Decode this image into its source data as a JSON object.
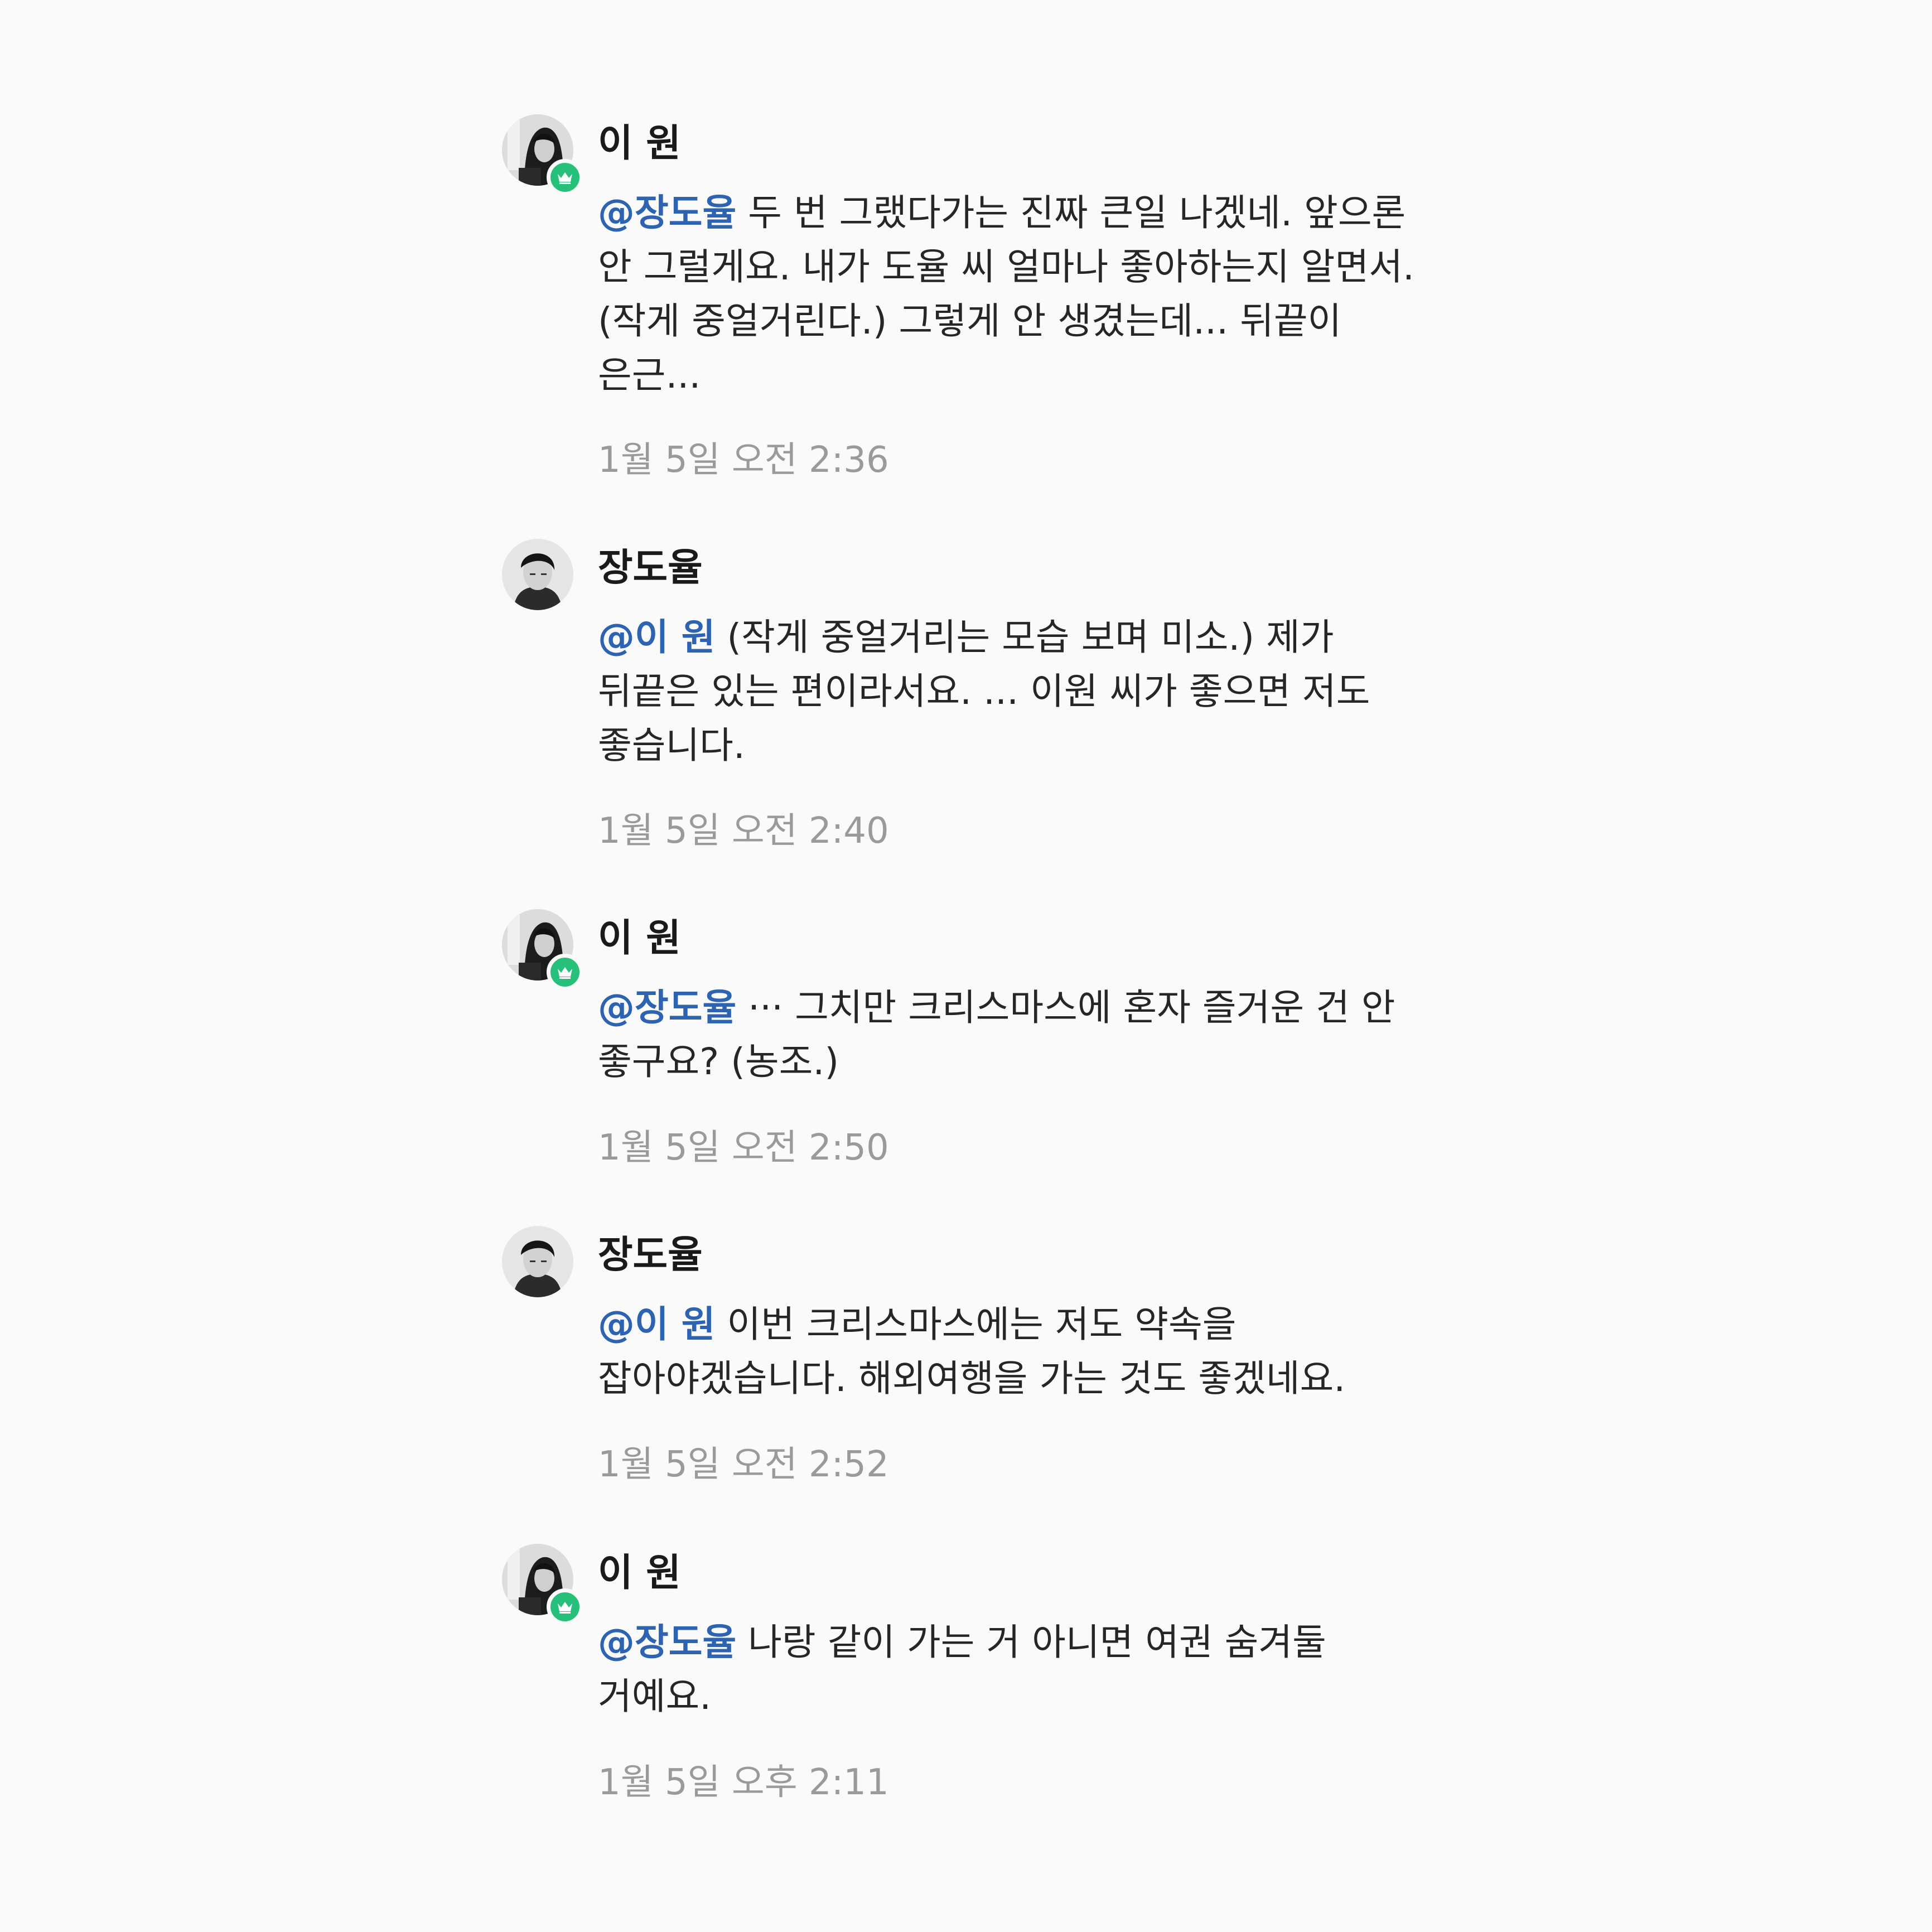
{
  "comments": [
    {
      "author": "이 원",
      "avatar_icon": "profile-photo-woman-dark-hair",
      "badge_icon": "crown-icon",
      "mention": "@장도율",
      "text": "두 번 그랬다가는 진짜 큰일 나겠네. 앞으론 안 그럴게요. 내가 도율 씨 얼마나 좋아하는지 알면서. (작게 중얼거린다.) 그렇게 안 생겼는데... 뒤끝이 은근...",
      "timestamp": "1월 5일 오전 2:36"
    },
    {
      "author": "장도율",
      "avatar_icon": "profile-photo-man-dark-hair",
      "badge_icon": "",
      "mention": "@이 원",
      "text": "(작게 중얼거리는 모습 보며 미소.) 제가 뒤끝은 있는 편이라서요. ... 이원 씨가 좋으면 저도 좋습니다.",
      "timestamp": "1월 5일 오전 2:40"
    },
    {
      "author": "이 원",
      "avatar_icon": "profile-photo-woman-dark-hair",
      "badge_icon": "crown-icon",
      "mention": "@장도율",
      "text": "··· 그치만 크리스마스에 혼자 즐거운 건 안 좋구요? (농조.)",
      "timestamp": "1월 5일 오전 2:50"
    },
    {
      "author": "장도율",
      "avatar_icon": "profile-photo-man-dark-hair",
      "badge_icon": "",
      "mention": "@이 원",
      "text": "이번 크리스마스에는 저도 약속을 잡아야겠습니다. 해외여행을 가는 것도 좋겠네요.",
      "timestamp": "1월 5일 오전 2:52"
    },
    {
      "author": "이 원",
      "avatar_icon": "profile-photo-woman-dark-hair",
      "badge_icon": "crown-icon",
      "mention": "@장도율",
      "text": "나랑 같이 가는 거 아니면 여권 숨겨둘 거예요.",
      "timestamp": "1월 5일 오후 2:11"
    }
  ],
  "colors": {
    "background": "#fafafa",
    "mention": "#2d63b0",
    "badge": "#27c07a",
    "timestamp": "#9a9a9a",
    "body_text": "#262626"
  }
}
